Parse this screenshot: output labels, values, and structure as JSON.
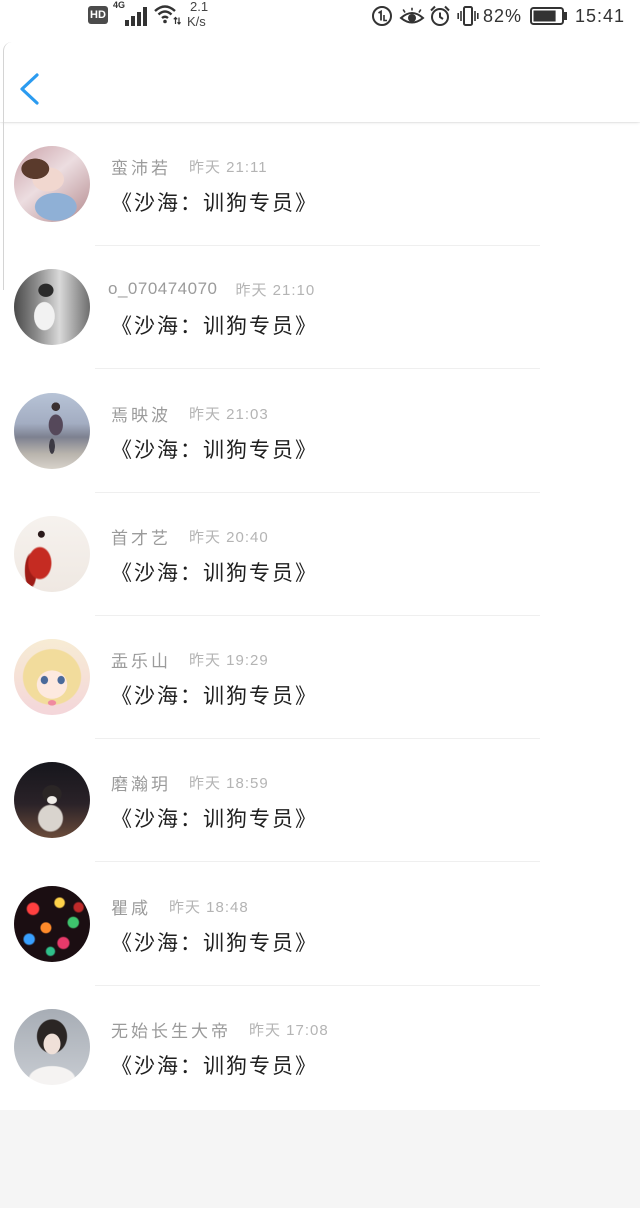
{
  "status_bar": {
    "hd_badge": "HD",
    "network_type": "4G",
    "speed_value": "2.1",
    "speed_unit": "K/s",
    "battery_percent": "82%",
    "battery_level": 0.82,
    "time": "15:41"
  },
  "icons": {
    "signal": "signal-bars-icon",
    "wifi": "wifi-icon",
    "status_circle": "circled-number-icon",
    "eye_comfort": "eye-icon",
    "alarm": "alarm-clock-icon",
    "vibrate": "vibrate-icon",
    "battery": "battery-icon",
    "back": "chevron-left-icon"
  },
  "colors": {
    "accent": "#2b9bf0",
    "name_text": "#9b9b9b",
    "time_text": "#b4b4b4",
    "message_text": "#1f1f1f",
    "divider": "#efefef",
    "page_background": "#f5f5f5",
    "status_text": "#333333"
  },
  "messages": [
    {
      "name": "蛮沛若",
      "time": "昨天 21:11",
      "text": "《沙海：训狗专员》"
    },
    {
      "name": "o_070474070",
      "time": "昨天 21:10",
      "text": "《沙海：训狗专员》"
    },
    {
      "name": "焉映波",
      "time": "昨天 21:03",
      "text": "《沙海：训狗专员》"
    },
    {
      "name": "首才艺",
      "time": "昨天 20:40",
      "text": "《沙海：训狗专员》"
    },
    {
      "name": "盂乐山",
      "time": "昨天 19:29",
      "text": "《沙海：训狗专员》"
    },
    {
      "name": "磨瀚玥",
      "time": "昨天 18:59",
      "text": "《沙海：训狗专员》"
    },
    {
      "name": "瞿咸",
      "time": "昨天 18:48",
      "text": "《沙海：训狗专员》"
    },
    {
      "name": "无始长生大帝",
      "time": "昨天 17:08",
      "text": "《沙海：训狗专员》"
    }
  ]
}
